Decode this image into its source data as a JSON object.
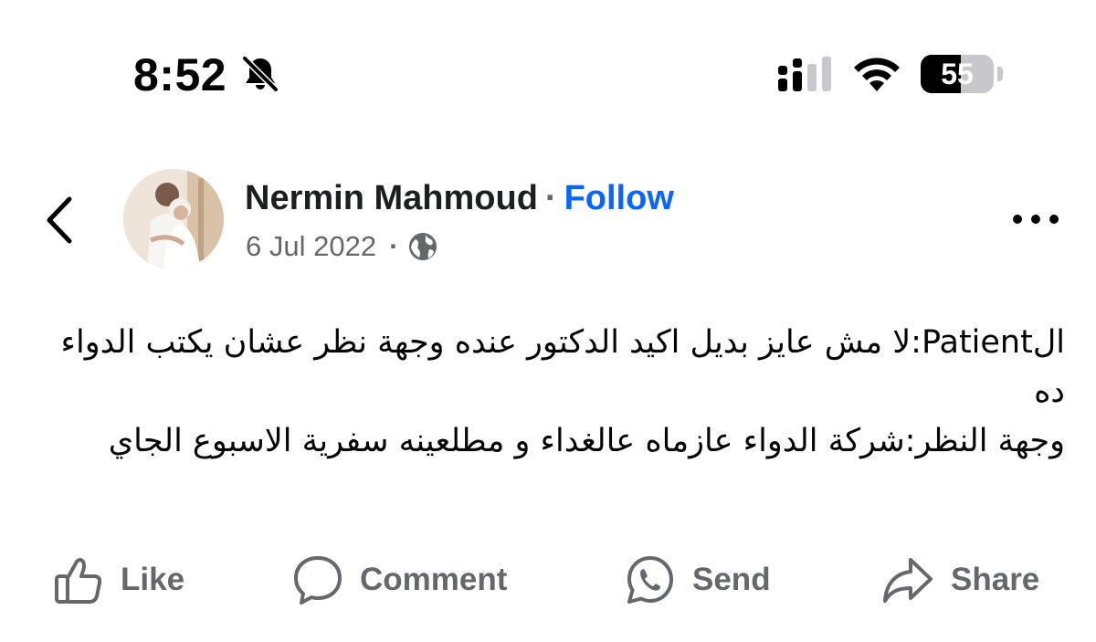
{
  "status_bar": {
    "time": "8:52",
    "battery_level": "55",
    "battery_fraction": 0.55,
    "icons": [
      "bell-slash-icon",
      "signal-icon",
      "wifi-icon",
      "battery-icon"
    ]
  },
  "post": {
    "author_name": "Nermin Mahmoud",
    "separator": "·",
    "follow_label": "Follow",
    "date": "6 Jul 2022",
    "meta_separator": "·",
    "privacy_icon": "globe-icon",
    "body_lines": [
      "الPatient:لا مش عايز بديل اكيد الدكتور عنده وجهة نظر عشان يكتب الدواء ده",
      "وجهة النظر:شركة الدواء عازماه عالغداء و مطلعينه سفرية الاسبوع الجاي"
    ]
  },
  "actions": {
    "like": "Like",
    "comment": "Comment",
    "send": "Send",
    "share": "Share"
  },
  "colors": {
    "follow_blue": "#0866ff",
    "secondary_text": "#65676b",
    "primary_text": "#1c1e21"
  }
}
